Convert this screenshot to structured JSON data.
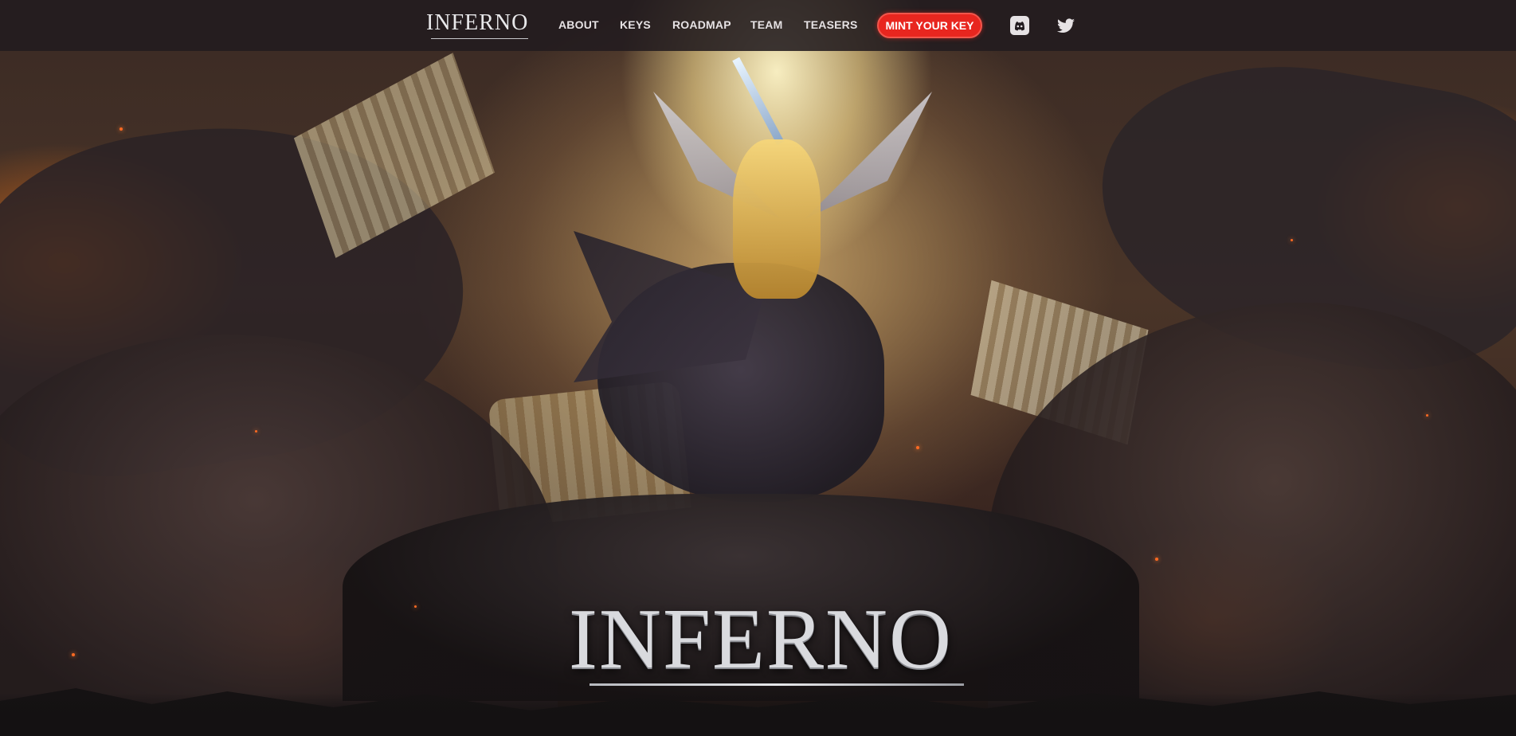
{
  "brand": {
    "logo_text": "INFERNO"
  },
  "nav": {
    "links": [
      {
        "label": "ABOUT"
      },
      {
        "label": "KEYS"
      },
      {
        "label": "ROADMAP"
      },
      {
        "label": "TEAM"
      },
      {
        "label": "TEASERS"
      }
    ],
    "cta_label": "MINT YOUR KEY",
    "social": [
      {
        "icon": "discord-icon"
      },
      {
        "icon": "twitter-icon"
      }
    ]
  },
  "hero": {
    "title": "INFERNO"
  },
  "colors": {
    "cta": "#e8261f",
    "nav_bg": "#221b1f",
    "nav_text": "#e6e2e4",
    "page_bg": "#141112"
  }
}
